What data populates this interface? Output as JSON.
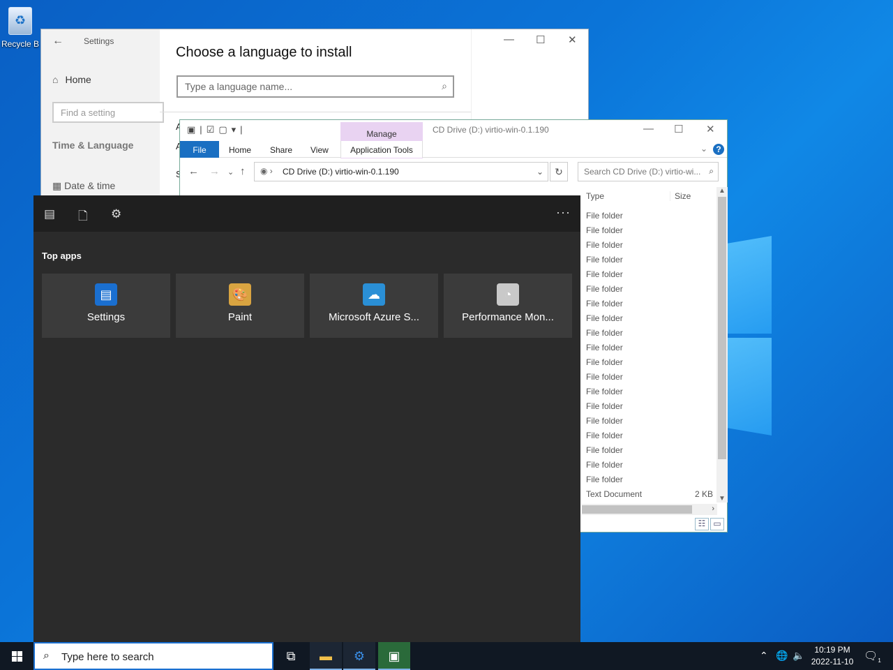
{
  "desktop": {
    "recycle_bin_label": "Recycle B"
  },
  "settings_window": {
    "title": "Settings",
    "home": "Home",
    "find_placeholder": "Find a setting",
    "category": "Time & Language",
    "date_time": "Date & time",
    "heading": "Choose a language to install",
    "lang_placeholder": "Type a language name...",
    "partial_1": "A",
    "partial_2": "A",
    "partial_3": "S"
  },
  "explorer_window": {
    "manage_label": "Manage",
    "title": "CD Drive (D:) virtio-win-0.1.190",
    "tabs": {
      "file": "File",
      "home": "Home",
      "share": "Share",
      "view": "View",
      "app_tools": "Application Tools"
    },
    "address": "CD Drive (D:) virtio-win-0.1.190",
    "search_placeholder": "Search CD Drive (D:) virtio-wi...",
    "columns": {
      "type": "Type",
      "size": "Size"
    },
    "rows": [
      {
        "type": "File folder",
        "size": ""
      },
      {
        "type": "File folder",
        "size": ""
      },
      {
        "type": "File folder",
        "size": ""
      },
      {
        "type": "File folder",
        "size": ""
      },
      {
        "type": "File folder",
        "size": ""
      },
      {
        "type": "File folder",
        "size": ""
      },
      {
        "type": "File folder",
        "size": ""
      },
      {
        "type": "File folder",
        "size": ""
      },
      {
        "type": "File folder",
        "size": ""
      },
      {
        "type": "File folder",
        "size": ""
      },
      {
        "type": "File folder",
        "size": ""
      },
      {
        "type": "File folder",
        "size": ""
      },
      {
        "type": "File folder",
        "size": ""
      },
      {
        "type": "File folder",
        "size": ""
      },
      {
        "type": "File folder",
        "size": ""
      },
      {
        "type": "File folder",
        "size": ""
      },
      {
        "type": "File folder",
        "size": ""
      },
      {
        "type": "File folder",
        "size": ""
      },
      {
        "type": "File folder",
        "size": ""
      },
      {
        "type": "Text Document",
        "size": "2 KB"
      }
    ]
  },
  "start_panel": {
    "section_title": "Top apps",
    "apps": [
      {
        "name": "Settings",
        "icon": "settings-app-icon",
        "color": "#1a6fd0"
      },
      {
        "name": "Paint",
        "icon": "paint-palette-icon",
        "color": "#d9a441"
      },
      {
        "name": "Microsoft Azure S...",
        "icon": "azure-storage-icon",
        "color": "#2a8fd6"
      },
      {
        "name": "Performance Mon...",
        "icon": "performance-gauge-icon",
        "color": "#c9c9c9"
      }
    ]
  },
  "taskbar": {
    "search_placeholder": "Type here to search",
    "time": "10:19 PM",
    "date": "2022-11-10",
    "notification_count": "1"
  }
}
